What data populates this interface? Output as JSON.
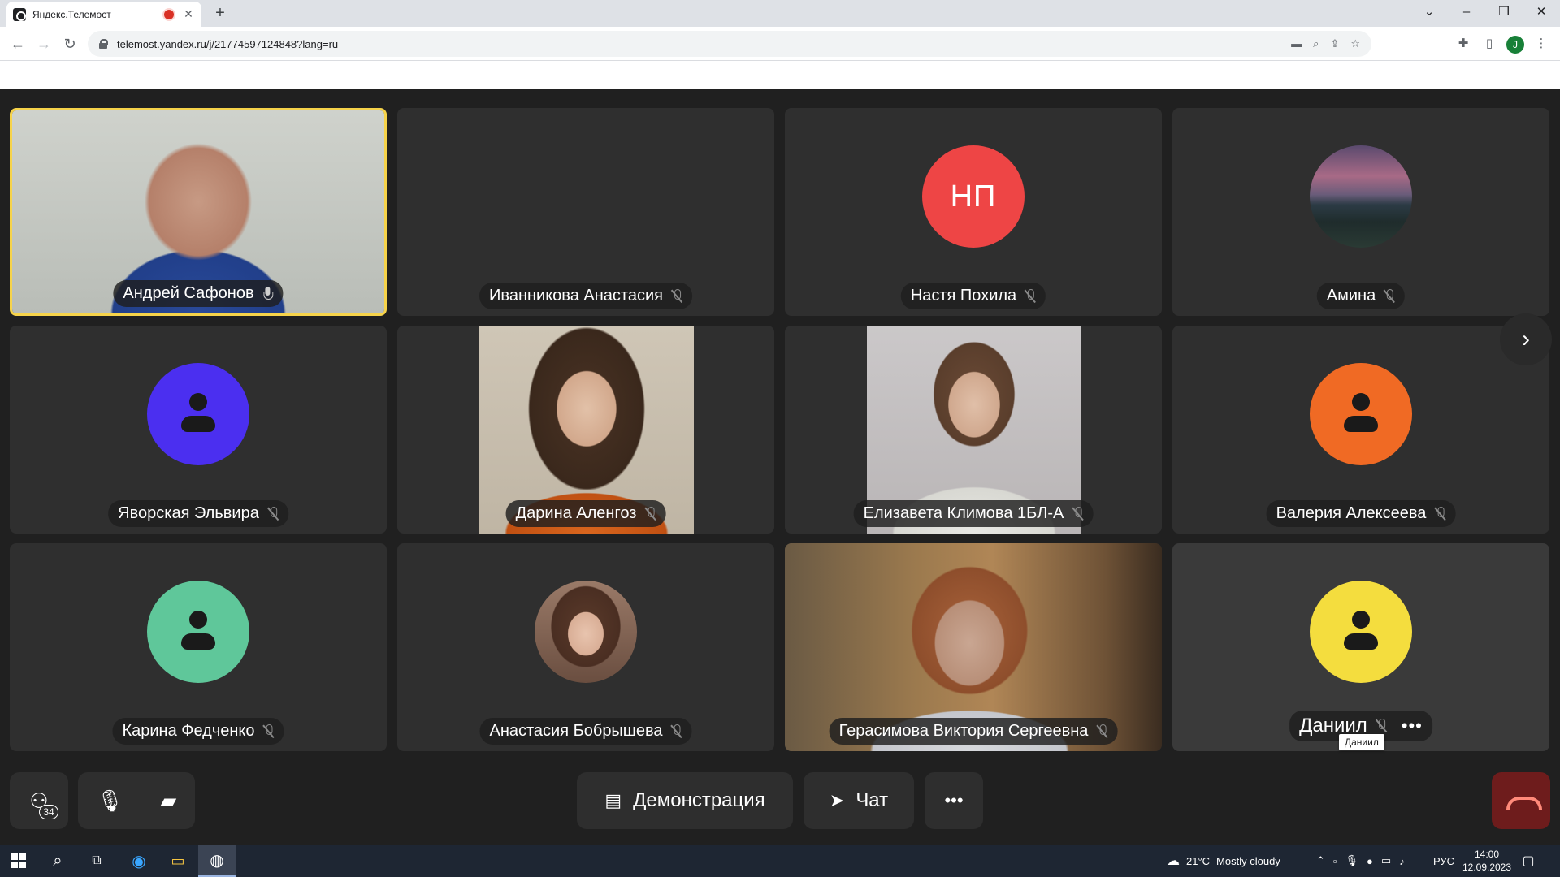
{
  "browser": {
    "tab_title": "Яндекс.Телемост",
    "url": "telemost.yandex.ru/j/21774597124848?lang=ru",
    "profile_initial": "J"
  },
  "participants": [
    {
      "name": "Андрей Сафонов",
      "mic": "on"
    },
    {
      "name": "Иванникова Анастасия",
      "mic": "off"
    },
    {
      "name": "Настя Похила",
      "mic": "off",
      "initials": "НП",
      "color": "#ee4545"
    },
    {
      "name": "Амина",
      "mic": "off"
    },
    {
      "name": "Яворская Эльвира",
      "mic": "off",
      "color": "#4b2ff0"
    },
    {
      "name": "Дарина Аленгоз",
      "mic": "off"
    },
    {
      "name": "Елизавета Климова 1БЛ-А",
      "mic": "off"
    },
    {
      "name": "Валерия Алексеева",
      "mic": "off",
      "color": "#f06a24"
    },
    {
      "name": "Карина Федченко",
      "mic": "off",
      "color": "#5fc79a"
    },
    {
      "name": "Анастасия Бобрышева",
      "mic": "off"
    },
    {
      "name": "Герасимова Виктория Сергеевна",
      "mic": "off"
    },
    {
      "name": "Даниил",
      "mic": "off",
      "color": "#f4dd3e"
    }
  ],
  "tooltip": "Даниил",
  "controls": {
    "participants_count": "34",
    "demo_label": "Демонстрация",
    "chat_label": "Чат"
  },
  "taskbar": {
    "weather_temp": "21°C",
    "weather_text": "Mostly cloudy",
    "lang": "РУС",
    "time": "14:00",
    "date": "12.09.2023"
  },
  "colors": {
    "active_speaker_border": "#f6d34a",
    "hangup": "#6e1c1c",
    "background": "#202020",
    "tile": "#2f2f2f"
  }
}
